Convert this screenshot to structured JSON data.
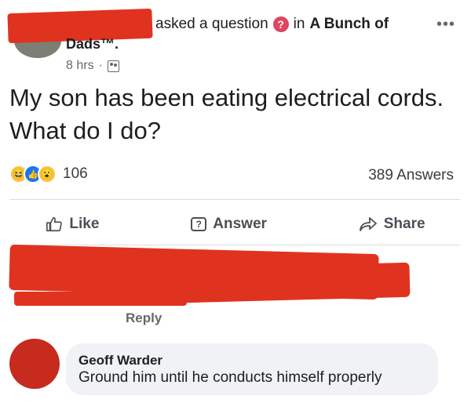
{
  "post": {
    "action_text": "asked a question",
    "in_text": "in",
    "group_name_line1": "A Bunch of",
    "group_name_line2": "Dads™.",
    "time": "8 hrs",
    "time_separator": "·",
    "question": "My son has been eating electrical cords. What do I do?",
    "reactions_count": "106",
    "answers_count": "389 Answers",
    "more_label": "•••"
  },
  "actions": {
    "like": "Like",
    "answer": "Answer",
    "share": "Share"
  },
  "comment": {
    "reply_label": "Reply"
  },
  "reply": {
    "author": "Geoff Warder",
    "text": "Ground him until he conducts himself properly"
  },
  "icons": {
    "question_badge": "question-badge-icon",
    "audience": "audience-icon",
    "like": "thumbs-up-icon",
    "answer": "answer-icon",
    "share": "share-arrow-icon"
  },
  "colors": {
    "redaction": "#e0331f",
    "question_badge": "#e0445e",
    "like_reaction": "#1877f2"
  }
}
